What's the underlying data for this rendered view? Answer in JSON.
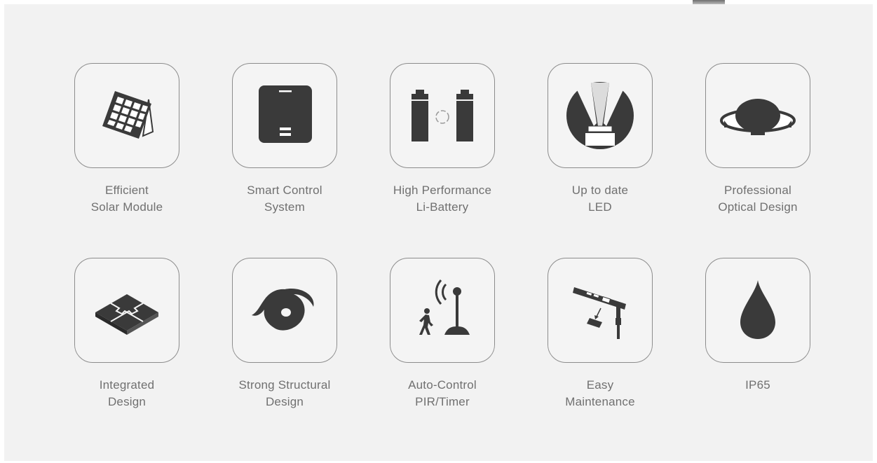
{
  "features": [
    {
      "icon": "solar-panel-icon",
      "lines": [
        "Efficient",
        "Solar Module"
      ]
    },
    {
      "icon": "control-box-icon",
      "lines": [
        "Smart Control",
        "System"
      ]
    },
    {
      "icon": "battery-icon",
      "lines": [
        "High Performance",
        "Li-Battery"
      ]
    },
    {
      "icon": "led-icon",
      "lines": [
        "Up to date",
        "LED"
      ]
    },
    {
      "icon": "optical-lens-icon",
      "lines": [
        "Professional",
        "Optical Design"
      ]
    },
    {
      "icon": "puzzle-icon",
      "lines": [
        "Integrated",
        "Design"
      ]
    },
    {
      "icon": "hurricane-icon",
      "lines": [
        "Strong Structural",
        "Design"
      ]
    },
    {
      "icon": "motion-sensor-icon",
      "lines": [
        "Auto-Control",
        "PIR/Timer"
      ]
    },
    {
      "icon": "street-light-maintenance-icon",
      "lines": [
        "Easy",
        "Maintenance"
      ]
    },
    {
      "icon": "water-drop-icon",
      "lines": [
        "IP65"
      ]
    }
  ]
}
